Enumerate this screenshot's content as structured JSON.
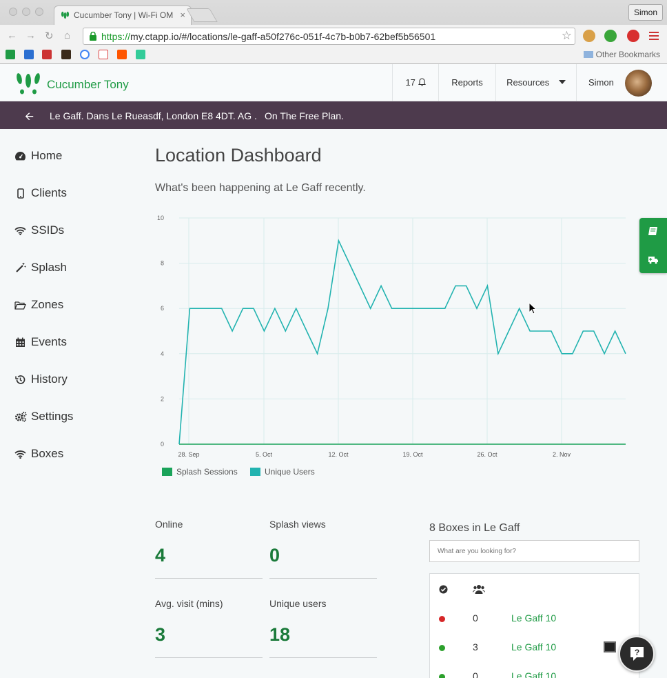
{
  "browser": {
    "tab_title": "Cucumber Tony | Wi-Fi OM",
    "tab_close": "×",
    "profile_name": "Simon",
    "url_scheme": "https://",
    "url_rest": "my.ctapp.io/#/locations/le-gaff-a50f276c-051f-4c7b-b0b7-62bef5b56501",
    "other_bookmarks": "Other Bookmarks"
  },
  "header": {
    "brand": "Cucumber Tony",
    "notifications_count": "17",
    "reports": "Reports",
    "resources": "Resources",
    "user": "Simon"
  },
  "location_bar": {
    "address": "Le Gaff. Dans Le Rueasdf, London E8 4DT. AG .",
    "plan": "On The Free Plan."
  },
  "sidebar": {
    "items": [
      {
        "label": "Home",
        "icon": "dashboard-icon"
      },
      {
        "label": "Clients",
        "icon": "mobile-icon"
      },
      {
        "label": "SSIDs",
        "icon": "wifi-icon"
      },
      {
        "label": "Splash",
        "icon": "magic-wand-icon"
      },
      {
        "label": "Zones",
        "icon": "folder-open-icon"
      },
      {
        "label": "Events",
        "icon": "calendar-icon"
      },
      {
        "label": "History",
        "icon": "history-icon"
      },
      {
        "label": "Settings",
        "icon": "gears-icon"
      },
      {
        "label": "Boxes",
        "icon": "wifi-icon"
      }
    ]
  },
  "main": {
    "title": "Location Dashboard",
    "subtitle": "What's been happening at Le Gaff recently."
  },
  "chart_data": {
    "type": "line",
    "x_tick_labels": [
      "28. Sep",
      "5. Oct",
      "12. Oct",
      "19. Oct",
      "26. Oct",
      "2. Nov"
    ],
    "ylim": [
      0,
      10
    ],
    "y_ticks": [
      "0",
      "2",
      "4",
      "6",
      "8",
      "10"
    ],
    "grid": true,
    "legend_position": "bottom-left",
    "series": [
      {
        "name": "Splash Sessions",
        "color": "#1aa35a",
        "values": [
          0,
          0,
          0,
          0,
          0,
          0,
          0,
          0,
          0,
          0,
          0,
          0,
          0,
          0,
          0,
          0,
          0,
          0,
          0,
          0,
          0,
          0,
          0,
          0,
          0,
          0,
          0,
          0,
          0,
          0,
          0,
          0,
          0,
          0,
          0,
          0,
          0,
          0,
          0,
          0,
          0,
          0,
          0,
          0,
          0
        ]
      },
      {
        "name": "Unique Users",
        "color": "#22b3b0",
        "values": [
          0,
          6,
          6,
          6,
          6,
          5,
          6,
          6,
          5,
          6,
          5,
          6,
          5,
          4,
          6,
          9,
          8,
          7,
          6,
          7,
          6,
          6,
          6,
          6,
          6,
          6,
          7,
          7,
          6,
          7,
          4,
          5,
          6,
          5,
          5,
          5,
          4,
          4,
          5,
          5,
          4,
          5,
          4
        ]
      }
    ]
  },
  "stats": {
    "online_label": "Online",
    "online_value": "4",
    "splash_label": "Splash views",
    "splash_value": "0",
    "visit_label": "Avg. visit (mins)",
    "visit_value": "3",
    "unique_label": "Unique users",
    "unique_value": "18"
  },
  "boxes": {
    "title": "8 Boxes in Le Gaff",
    "search_placeholder": "What are you looking for?",
    "rows": [
      {
        "status_color": "#d62728",
        "count": "0",
        "name": "Le Gaff 10"
      },
      {
        "status_color": "#2ca02c",
        "count": "3",
        "name": "Le Gaff 10"
      },
      {
        "status_color": "#2ca02c",
        "count": "0",
        "name": "Le Gaff 10"
      }
    ]
  },
  "colors": {
    "brand_green": "#1f9b45",
    "location_bar": "#4d3a4d",
    "line": "#22b3b0"
  }
}
